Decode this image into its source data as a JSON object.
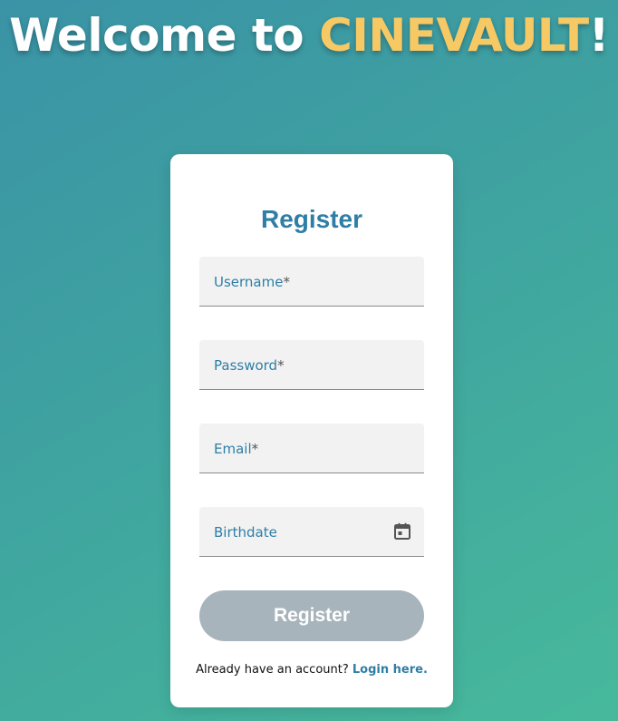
{
  "header": {
    "welcome_prefix": "Welcome to ",
    "brand_name": "CINEVAULT",
    "welcome_suffix": "!"
  },
  "form": {
    "title": "Register",
    "fields": [
      {
        "label": "Username",
        "required_marker": "*"
      },
      {
        "label": "Password",
        "required_marker": "*"
      },
      {
        "label": "Email",
        "required_marker": "*"
      },
      {
        "label": "Birthdate",
        "required_marker": "",
        "icon": "calendar-icon"
      }
    ],
    "submit_label": "Register",
    "login_prompt": "Already have an account? ",
    "login_link": "Login here."
  },
  "colors": {
    "brand": "#f6c965",
    "accent": "#2f7ea6",
    "button_disabled": "#a8b4bc",
    "field_background": "#f2f2f2"
  }
}
